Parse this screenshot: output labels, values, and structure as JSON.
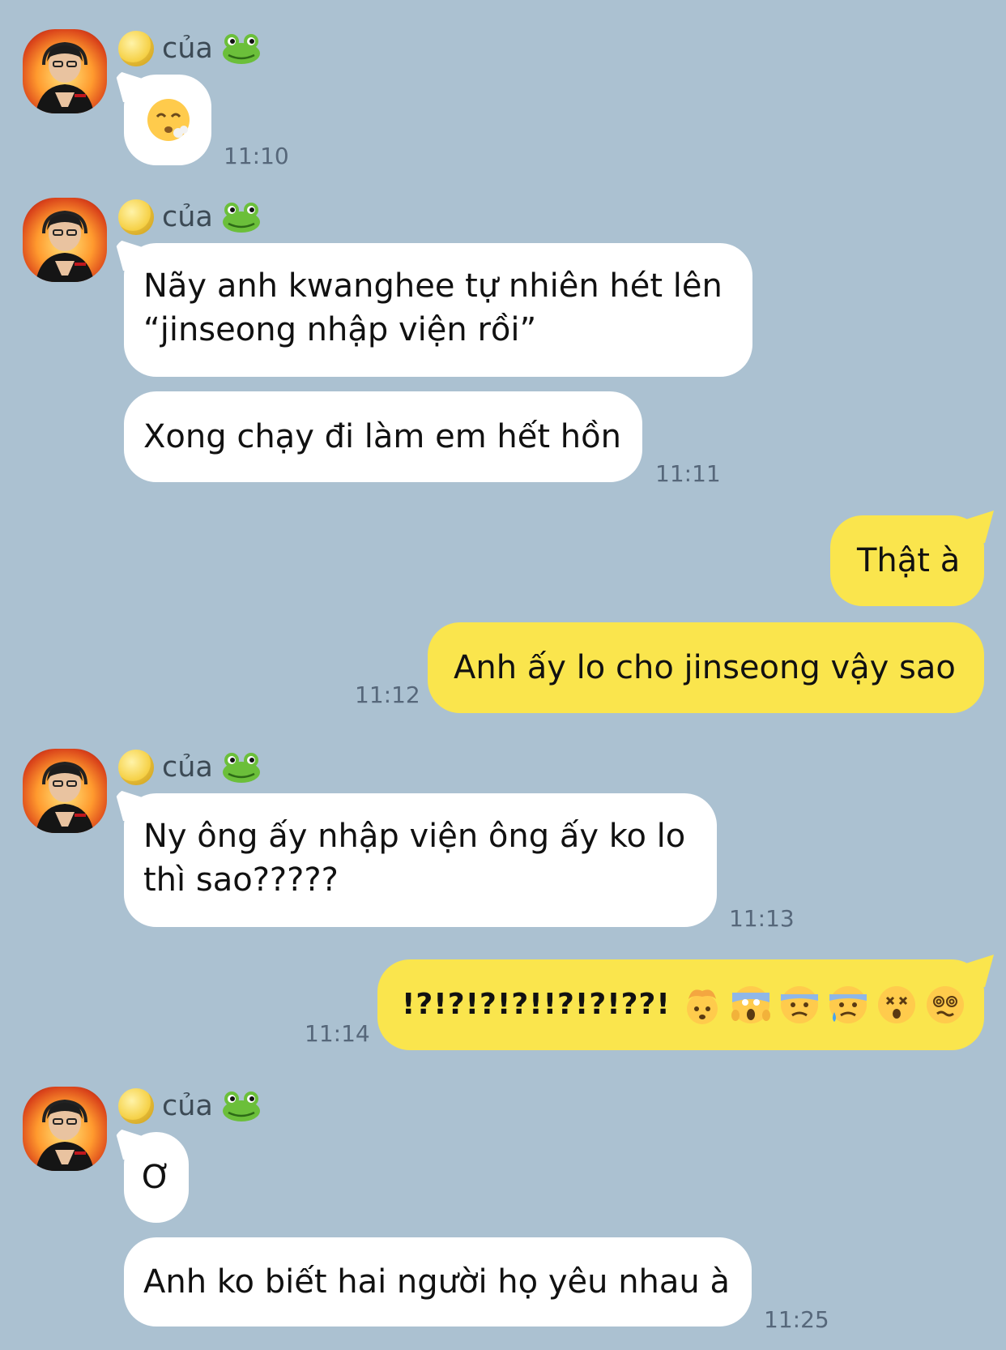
{
  "sender": {
    "text": "của",
    "moon_icon": "full-moon-emoji",
    "frog_icon": "frog-emoji"
  },
  "messages": [
    {
      "id": "m1",
      "direction": "incoming",
      "content": "😮‍💨",
      "time": "11:10"
    },
    {
      "id": "m2",
      "direction": "incoming",
      "lines": [
        "Nãy anh kwanghee tự nhiên hét lên",
        "“jinseong nhập viện rồi”"
      ]
    },
    {
      "id": "m3",
      "direction": "incoming",
      "text": "Xong chạy đi làm em hết hồn",
      "time": "11:11"
    },
    {
      "id": "m4",
      "direction": "outgoing",
      "text": "Thật à"
    },
    {
      "id": "m5",
      "direction": "outgoing",
      "text": "Anh ấy lo cho jinseong vậy sao",
      "time": "11:12"
    },
    {
      "id": "m6",
      "direction": "incoming",
      "lines": [
        "Ny ông ấy nhập viện ông ấy ko lo",
        "thì sao?????"
      ],
      "time": "11:13"
    },
    {
      "id": "m7",
      "direction": "outgoing",
      "text": "!?!?!?!?!!?!?!??!",
      "emojis": [
        "exploding-head",
        "face-screaming-in-fear",
        "anxious-face",
        "anxious-face-with-sweat",
        "dizzy-face",
        "face-with-spiral-eyes"
      ],
      "time": "11:14"
    },
    {
      "id": "m8",
      "direction": "incoming",
      "text": "Ơ"
    },
    {
      "id": "m9",
      "direction": "incoming",
      "text": "Anh ko biết hai người họ yêu nhau à",
      "time": "11:25"
    }
  ],
  "colors": {
    "background": "#abc1d1",
    "incoming_bubble": "#ffffff",
    "outgoing_bubble": "#fae54d",
    "timestamp": "#56677a"
  }
}
